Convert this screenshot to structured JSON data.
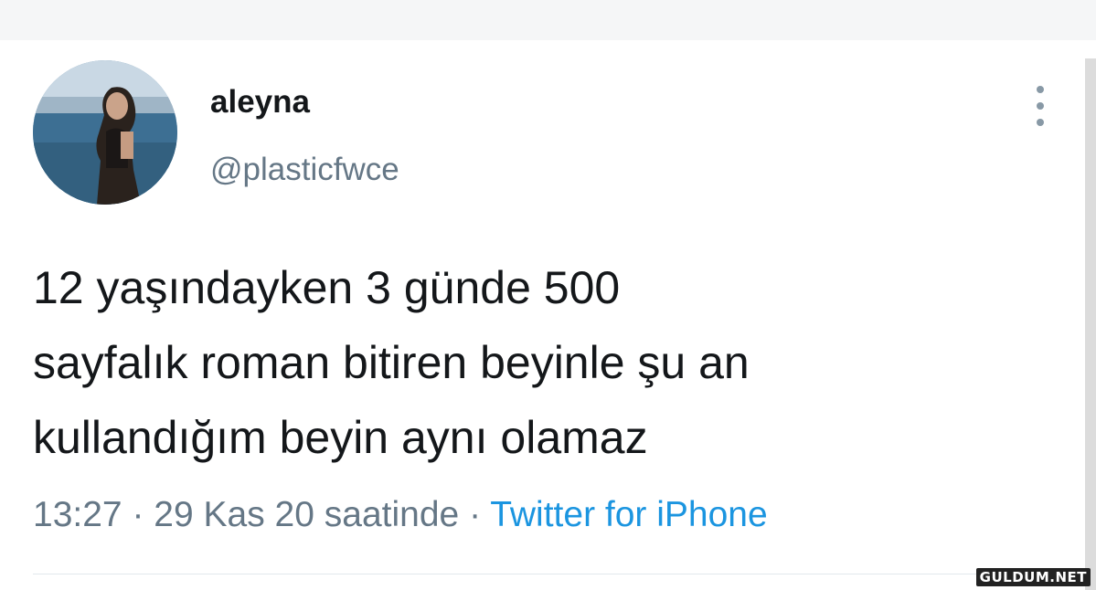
{
  "user": {
    "display_name": "aleyna",
    "handle": "@plasticfwce"
  },
  "tweet": {
    "text_lines": [
      "12 yaşındayken 3 günde 500",
      "sayfalık roman bitiren beyinle şu an",
      "kullandığım beyin aynı olamaz"
    ],
    "time": "13:27",
    "date": "29 Kas 20 saatinde",
    "separator": "·",
    "source": "Twitter for iPhone"
  },
  "icons": {
    "menu": "more-vertical-icon",
    "avatar": "profile-photo"
  },
  "colors": {
    "text": "#14171a",
    "secondary": "#657786",
    "link": "#1b95e0",
    "divider": "#e1e8ed"
  },
  "watermark": "GULDUM.NET"
}
